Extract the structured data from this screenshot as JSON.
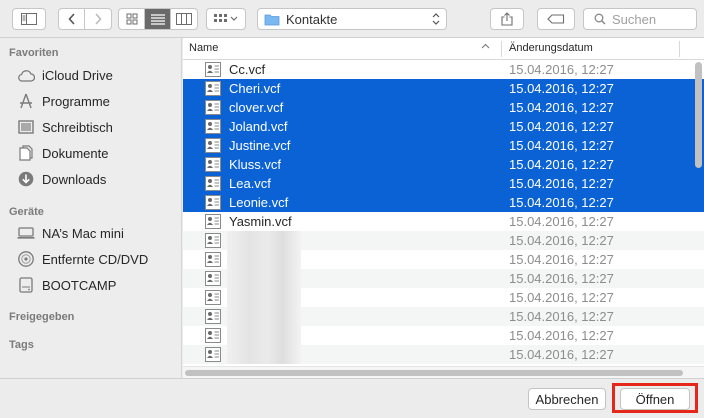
{
  "toolbar": {
    "location": "Kontakte",
    "search_placeholder": "Suchen"
  },
  "sidebar": {
    "favorites_label": "Favoriten",
    "favorites": [
      {
        "label": "iCloud Drive",
        "icon": "cloud-icon"
      },
      {
        "label": "Programme",
        "icon": "apps-icon"
      },
      {
        "label": "Schreibtisch",
        "icon": "desktop-icon"
      },
      {
        "label": "Dokumente",
        "icon": "document-icon"
      },
      {
        "label": "Downloads",
        "icon": "download-icon"
      }
    ],
    "devices_label": "Geräte",
    "devices": [
      {
        "label": "NA’s Mac mini",
        "icon": "computer-icon"
      },
      {
        "label": "Entfernte CD/DVD",
        "icon": "disc-icon"
      },
      {
        "label": "BOOTCAMP",
        "icon": "drive-icon"
      }
    ],
    "shared_label": "Freigegeben",
    "tags_label": "Tags"
  },
  "list": {
    "col_name": "Name",
    "col_date": "Änderungsdatum",
    "files": [
      {
        "name": "Cc.vcf",
        "date": "15.04.2016, 12:27",
        "selected": false
      },
      {
        "name": "Cheri.vcf",
        "date": "15.04.2016, 12:27",
        "selected": true
      },
      {
        "name": "clover.vcf",
        "date": "15.04.2016, 12:27",
        "selected": true
      },
      {
        "name": "Joland.vcf",
        "date": "15.04.2016, 12:27",
        "selected": true
      },
      {
        "name": "Justine.vcf",
        "date": "15.04.2016, 12:27",
        "selected": true
      },
      {
        "name": "Kluss.vcf",
        "date": "15.04.2016, 12:27",
        "selected": true
      },
      {
        "name": "Lea.vcf",
        "date": "15.04.2016, 12:27",
        "selected": true
      },
      {
        "name": "Leonie.vcf",
        "date": "15.04.2016, 12:27",
        "selected": true
      },
      {
        "name": "Yasmin.vcf",
        "date": "15.04.2016, 12:27",
        "selected": false
      },
      {
        "name": "",
        "date": "15.04.2016, 12:27",
        "selected": false
      },
      {
        "name": "",
        "date": "15.04.2016, 12:27",
        "selected": false
      },
      {
        "name": "",
        "date": "15.04.2016, 12:27",
        "selected": false
      },
      {
        "name": "",
        "date": "15.04.2016, 12:27",
        "selected": false
      },
      {
        "name": "",
        "date": "15.04.2016, 12:27",
        "selected": false
      },
      {
        "name": "",
        "date": "15.04.2016, 12:27",
        "selected": false
      },
      {
        "name": "",
        "date": "15.04.2016, 12:27",
        "selected": false
      }
    ]
  },
  "buttons": {
    "cancel": "Abbrechen",
    "open": "Öffnen"
  },
  "colors": {
    "selection": "#0a62d5",
    "highlight": "#e5261a"
  }
}
